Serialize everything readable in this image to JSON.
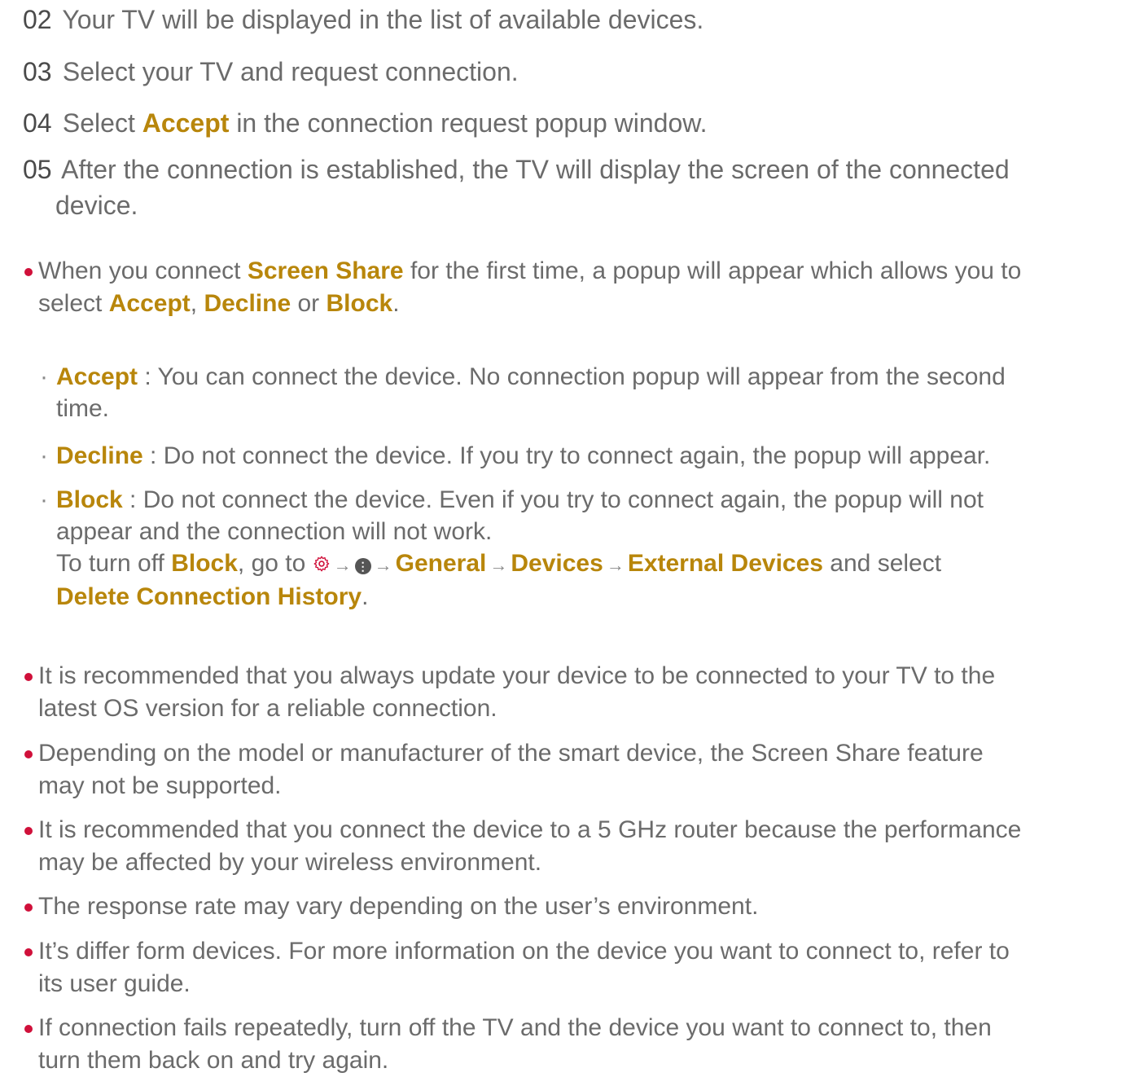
{
  "steps": [
    {
      "num": "02",
      "text": "Your TV will be displayed in the list of available devices."
    },
    {
      "num": "03",
      "text": "Select your TV and request connection."
    },
    {
      "num": "04",
      "pre": "Select ",
      "hl": "Accept",
      "post": " in the connection request popup window."
    },
    {
      "num": "05",
      "line1": "After the connection is established, the TV will display the screen of the connected",
      "line2": "device."
    }
  ],
  "bullet_first": {
    "t1": "When you connect ",
    "h1": "Screen Share",
    "t2": " for the first time, a popup will appear which allows you to",
    "t3": "select ",
    "h2": "Accept",
    "t4": ", ",
    "h3": "Decline",
    "t5": " or ",
    "h4": "Block",
    "t6": "."
  },
  "sub_items": {
    "accept": {
      "label": "Accept",
      "text1": " : You can connect the device. No connection popup will appear from the second",
      "text2": "time."
    },
    "decline": {
      "label": "Decline",
      "text1": " : Do not connect the device. If you try to connect again, the popup will appear."
    },
    "block": {
      "label": "Block",
      "text1": " : Do not connect the device. Even if you try to connect again, the popup will not",
      "text2": "appear and the connection will not work.",
      "turnoff_pre": "To turn off ",
      "turnoff_hl": "Block",
      "turnoff_mid": ", go to ",
      "arrow": "→",
      "info_glyph": "⋮",
      "path_general": "General",
      "path_devices": "Devices",
      "path_external": "External Devices",
      "and_select": " and select",
      "delete_label": "Delete Connection History",
      "end": "."
    }
  },
  "bullets": [
    {
      "line1": "It is recommended that you always update your device to be connected to your TV to the",
      "line2": "latest OS version for a reliable connection."
    },
    {
      "line1": "Depending on the model or manufacturer of the smart device, the Screen Share feature",
      "line2": "may not be supported."
    },
    {
      "line1": "It is recommended that you connect the device to a 5 GHz router because the performance",
      "line2": "may be affected by your wireless environment."
    },
    {
      "line1": "The response rate may vary depending on the user’s environment."
    },
    {
      "line1": "It’s differ form devices. For more information on the device you want to connect to, refer to",
      "line2": "its user guide."
    },
    {
      "line1": "If connection fails repeatedly, turn off the TV and the device you want to connect to, then",
      "line2": "turn them back on and try again."
    }
  ],
  "icons": {
    "gear": "settings-gear-icon",
    "info": "more-options-icon",
    "arrow": "arrow-right-icon"
  },
  "colors": {
    "highlight": "#b8860b",
    "bullet": "#d0103a",
    "text": "#6b6b6b",
    "number": "#4a4a4a"
  }
}
